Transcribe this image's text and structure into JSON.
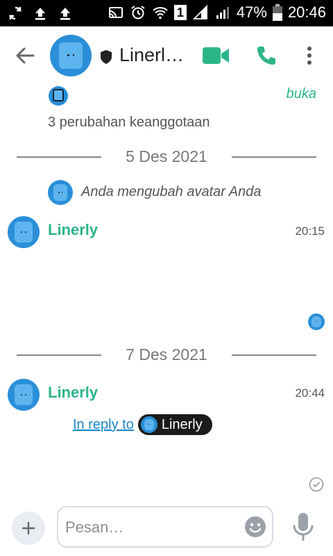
{
  "status_bar": {
    "battery_percent": "47%",
    "time": "20:46",
    "sim_badge": "1",
    "icons": [
      "sync-icon",
      "upload-icon",
      "upload-icon",
      "cast-icon",
      "alarm-icon",
      "wifi-icon",
      "sim-badge",
      "signal-icon",
      "signal-icon",
      "battery-icon"
    ]
  },
  "toolbar": {
    "title": "Linerl…",
    "back_icon": "arrow-left-icon",
    "shield_icon": "shield-icon",
    "video_icon": "video-call-icon",
    "phone_icon": "phone-call-icon",
    "more_icon": "more-vertical-icon",
    "accent_color": "#2db58a"
  },
  "chat": {
    "open_link": "buka",
    "membership_changes": "3 perubahan keanggotaan",
    "date_1": "5 Des 2021",
    "system_message": "Anda mengubah avatar Anda",
    "message_1": {
      "sender": "Linerly",
      "time": "20:15"
    },
    "date_2": "7 Des 2021",
    "message_2": {
      "sender": "Linerly",
      "time": "20:44",
      "reply_link": "In reply to",
      "mention": "Linerly"
    }
  },
  "composer": {
    "placeholder": "Pesan…",
    "plus_icon": "plus-icon",
    "emoji_icon": "emoji-icon",
    "mic_icon": "microphone-icon"
  }
}
